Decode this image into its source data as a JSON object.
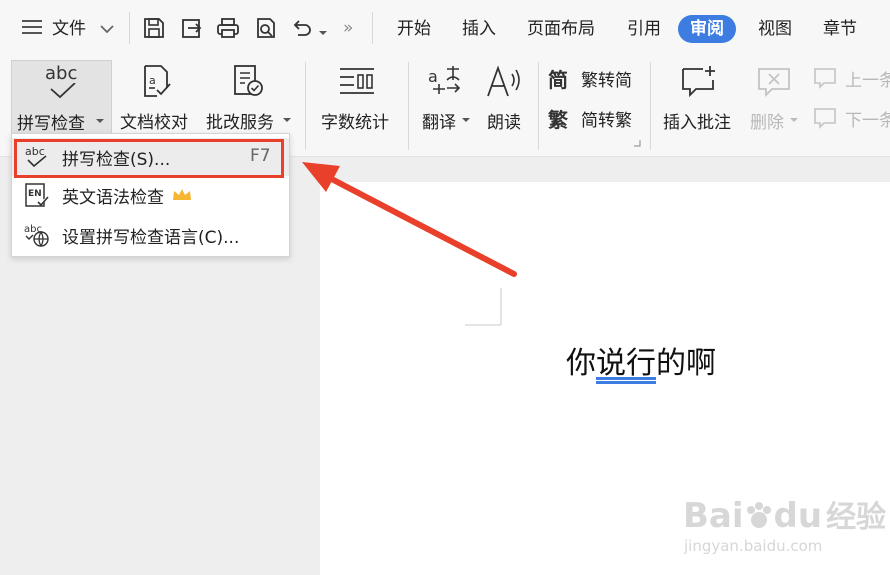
{
  "titlebar": {
    "menu_label": "文件",
    "tabs": [
      {
        "label": "开始"
      },
      {
        "label": "插入"
      },
      {
        "label": "页面布局"
      },
      {
        "label": "引用"
      },
      {
        "label": "审阅",
        "active": true
      },
      {
        "label": "视图"
      },
      {
        "label": "章节"
      }
    ]
  },
  "ribbon": {
    "spell_check": "拼写检查",
    "doc_proof": "文档校对",
    "review_service": "批改服务",
    "word_count": "字数统计",
    "translate": "翻译",
    "read_aloud": "朗读",
    "trad_to_simp": "繁转简",
    "simp_to_trad": "简转繁",
    "insert_comment": "插入批注",
    "delete": "删除",
    "prev": "上一条",
    "next": "下一条",
    "spell_icon_text": "abc"
  },
  "dropdown": {
    "items": [
      {
        "label": "拼写检查(S)...",
        "shortcut": "F7",
        "icon_text": "abc"
      },
      {
        "label": "英文语法检查",
        "icon_text": "EN"
      },
      {
        "label": "设置拼写检查语言(C)...",
        "icon_text": "abc"
      }
    ]
  },
  "document": {
    "text_before": "你",
    "text_underlined": "说行",
    "text_after": "的啊"
  },
  "watermark": {
    "brand": "Bai",
    "brand2": "du",
    "brand3": "经验",
    "url": "jingyan.baidu.com"
  },
  "colors": {
    "accent": "#3d7ce0",
    "highlight_box": "#e8402a",
    "arrow": "#e8402a",
    "crown": "#f5b731",
    "underline": "#3d7ce0"
  }
}
